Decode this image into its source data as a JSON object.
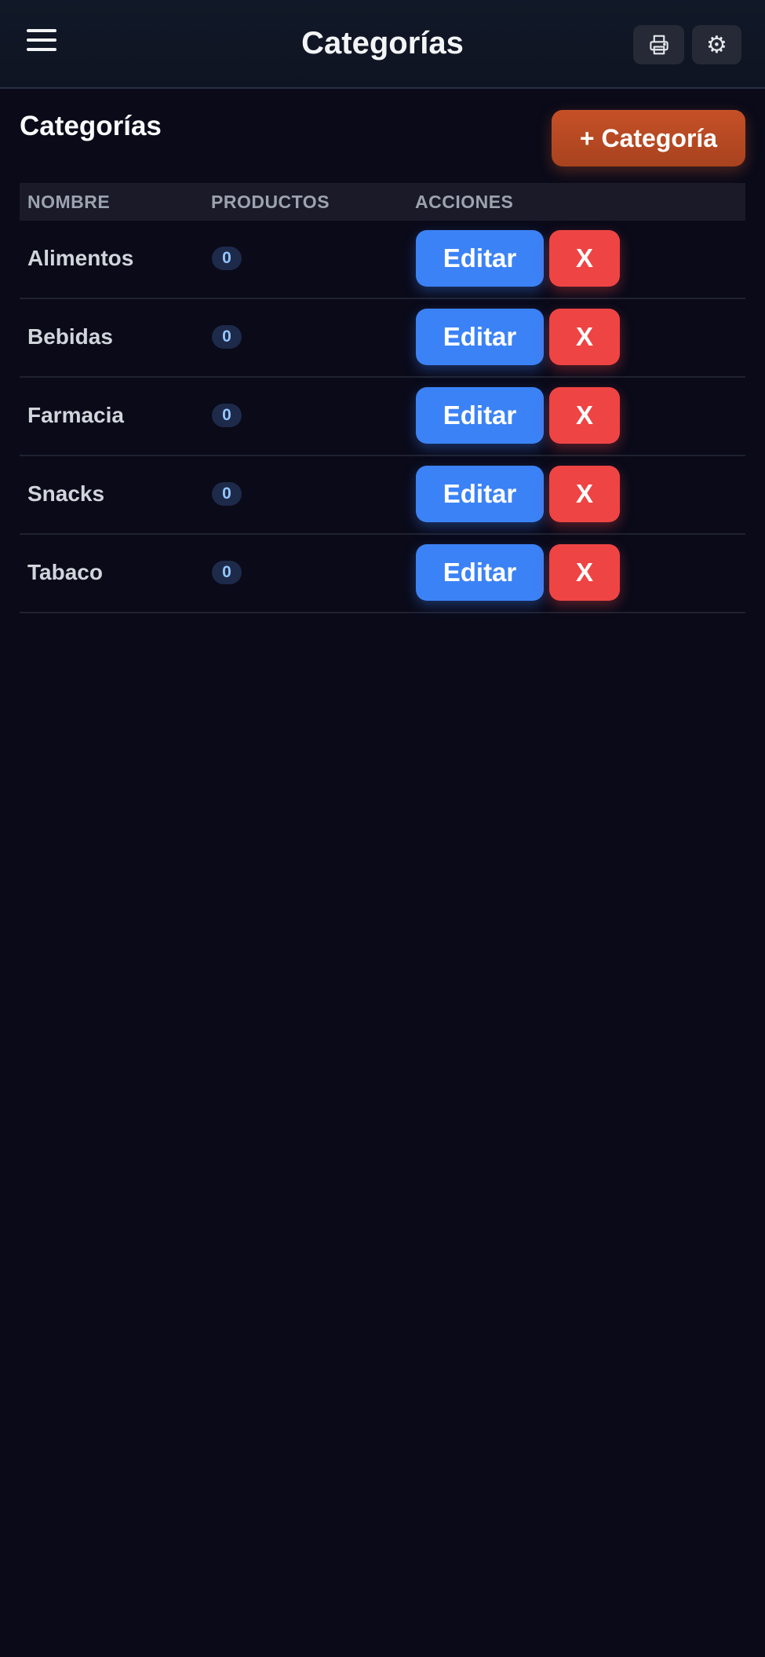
{
  "header": {
    "title": "Categorías",
    "menu_icon": "hamburger-menu-icon",
    "print_icon": "printer-icon",
    "settings_icon": "⚙"
  },
  "page": {
    "title": "Categorías",
    "add_button_label": "+ Categoría"
  },
  "table": {
    "columns": [
      "NOMBRE",
      "PRODUCTOS",
      "ACCIONES"
    ],
    "rows": [
      {
        "name": "Alimentos",
        "products": "0",
        "edit_label": "Editar",
        "delete_label": "X"
      },
      {
        "name": "Bebidas",
        "products": "0",
        "edit_label": "Editar",
        "delete_label": "X"
      },
      {
        "name": "Farmacia",
        "products": "0",
        "edit_label": "Editar",
        "delete_label": "X"
      },
      {
        "name": "Snacks",
        "products": "0",
        "edit_label": "Editar",
        "delete_label": "X"
      },
      {
        "name": "Tabaco",
        "products": "0",
        "edit_label": "Editar",
        "delete_label": "X"
      }
    ]
  },
  "colors": {
    "background": "#0a0a19",
    "topbar": "#111827",
    "primary_button": "#3b82f6",
    "danger_button": "#ef4444",
    "accent_button": "#c65027",
    "badge_text": "#93c5fd"
  }
}
